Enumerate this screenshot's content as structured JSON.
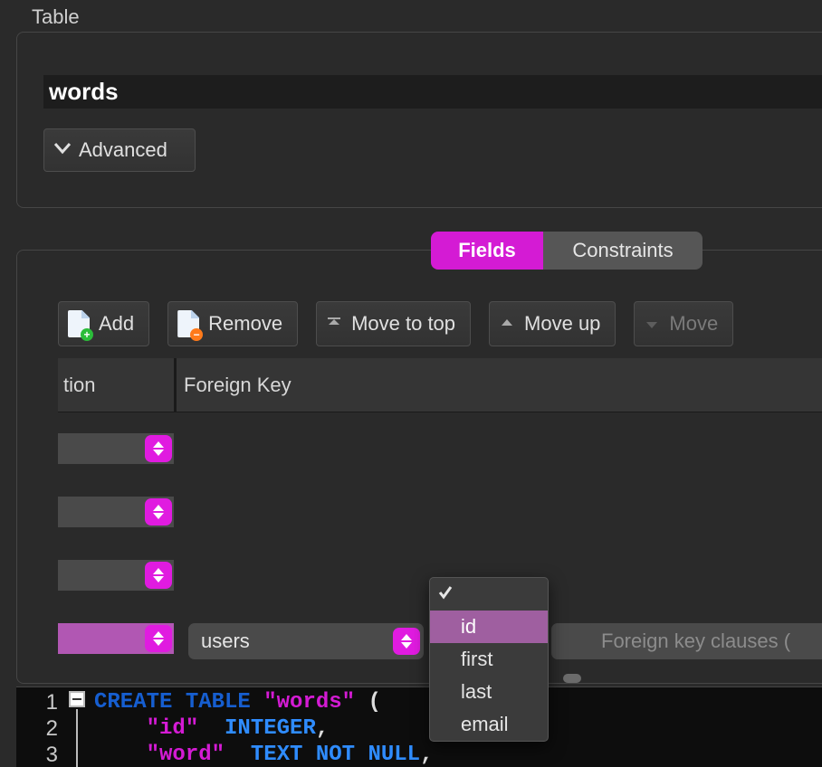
{
  "section_label": "Table",
  "table_name": "words",
  "advanced_label": "Advanced",
  "tabs": {
    "fields": "Fields",
    "constraints": "Constraints"
  },
  "toolbar": {
    "add": "Add",
    "remove": "Remove",
    "move_top": "Move to top",
    "move_up": "Move up",
    "move_partial": "Move"
  },
  "grid": {
    "col1_partial": "tion",
    "col2": "Foreign Key"
  },
  "fk": {
    "table": "users",
    "clauses_placeholder": "Foreign key clauses ("
  },
  "dropdown": {
    "blank": "",
    "items": [
      "id",
      "first",
      "last",
      "email"
    ],
    "selected_index": 0
  },
  "sql": {
    "line_numbers": [
      "1",
      "2",
      "3"
    ],
    "l1": {
      "kw": "CREATE TABLE ",
      "tbl": "\"words\"",
      "open": " ("
    },
    "l2": {
      "indent": "    ",
      "col": "\"id\"",
      "sp": "  ",
      "type": "INTEGER",
      "comma": ","
    },
    "l3": {
      "indent": "    ",
      "col": "\"word\"",
      "sp": "  ",
      "type": "TEXT NOT NULL",
      "comma": ","
    }
  }
}
